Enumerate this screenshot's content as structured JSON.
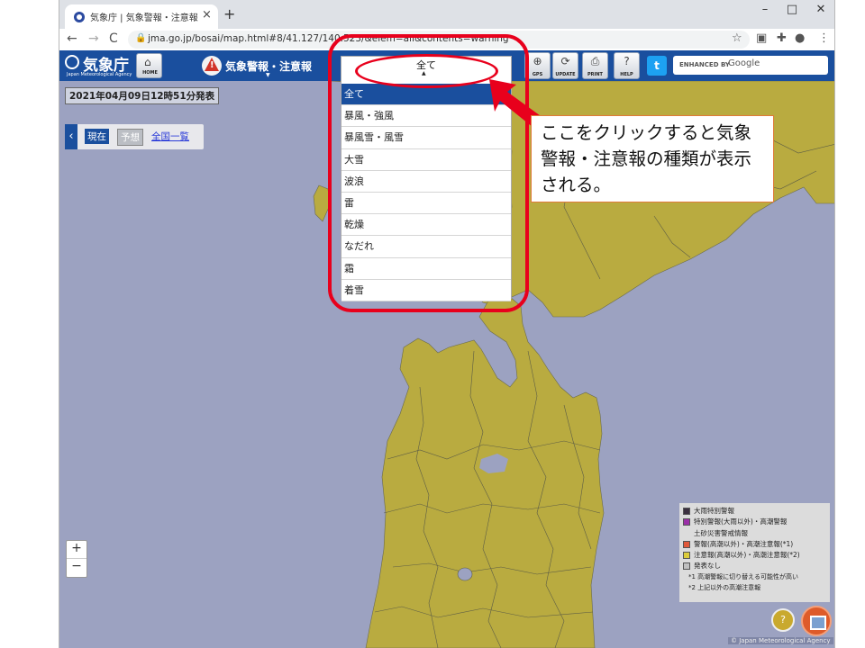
{
  "browser": {
    "tab_title": "気象庁 | 気象警報・注意報",
    "tab_close": "×",
    "new_tab": "+",
    "window_controls": [
      "–",
      "□",
      "✕"
    ],
    "url": "jma.go.jp/bosai/map.html#8/41.127/140.523/&elem=all&contents=warning",
    "nav": [
      "←",
      "→",
      "C"
    ]
  },
  "header": {
    "logo": "気象庁",
    "logo_sub": "Japan Meteorological Agency",
    "home_label": "HOME",
    "menu_title": "気象警報・注意報",
    "buttons": [
      {
        "label": "GPS",
        "glyph": "⊕"
      },
      {
        "label": "UPDATE",
        "glyph": "⟳"
      },
      {
        "label": "PRINT",
        "glyph": "⎙"
      },
      {
        "label": "HELP",
        "glyph": "?"
      }
    ],
    "search_enhanced": "ENHANCED BY",
    "search_google": "Google"
  },
  "map": {
    "issued": "2021年04月09日12時51分発表",
    "now_label": "現在",
    "forecast_label": "予想",
    "national_link": "全国一覧",
    "zoom_in": "+",
    "zoom_out": "−",
    "copyright": "© Japan Meteorological Agency"
  },
  "dropdown": {
    "selected": "全て",
    "items": [
      "全て",
      "暴風・強風",
      "暴風雪・風雪",
      "大雪",
      "波浪",
      "雷",
      "乾燥",
      "なだれ",
      "霜",
      "着雪"
    ]
  },
  "annotation": {
    "text": "ここをクリックすると気象警報・注意報の種類が表示される。"
  },
  "legend": {
    "items": [
      {
        "label": "大雨特別警報",
        "color": "#3b3040"
      },
      {
        "label": "特別警報(大雨以外)・高潮警報",
        "color": "#9b2fa8"
      },
      {
        "label": "土砂災害警戒情報",
        "color": ""
      },
      {
        "label": "警報(高潮以外)・高潮注意報(*1)",
        "color": "#e0583a"
      },
      {
        "label": "注意報(高潮以外)・高潮注意報(*2)",
        "color": "#dccc3a"
      },
      {
        "label": "発表なし",
        "color": "#c0c0c0"
      }
    ],
    "notes": [
      "*1 高潮警報に切り替える可能性が高い",
      "*2 上記以外の高潮注意報"
    ]
  },
  "colors": {
    "land": "#b9ab40",
    "sea": "#9ca2c1",
    "header": "#1a4f9e",
    "annotation_red": "#e8001c"
  }
}
